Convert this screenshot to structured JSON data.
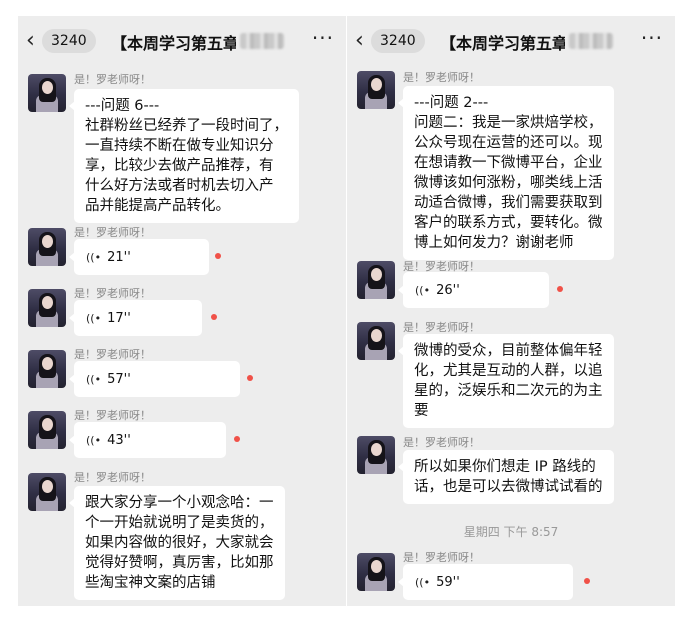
{
  "left_panel": {
    "back_count": "3240",
    "title": "【本周学习第五章",
    "more_label": "···",
    "messages": [
      {
        "type": "text",
        "sender": "是！罗老师呀！",
        "lines": [
          "---问题 6---",
          "社群粉丝已经养了一段时间了，",
          "一直持续不断在做专业知识分",
          "享，比较少去做产品推荐，有",
          "什么好方法或者时机去切入产",
          "品并能提高产品转化。"
        ]
      },
      {
        "type": "voice",
        "sender": "是！罗老师呀！",
        "duration": "21''"
      },
      {
        "type": "voice",
        "sender": "是！罗老师呀！",
        "duration": "17''"
      },
      {
        "type": "voice",
        "sender": "是！罗老师呀！",
        "duration": "57''"
      },
      {
        "type": "voice",
        "sender": "是！罗老师呀！",
        "duration": "43''"
      },
      {
        "type": "text",
        "sender": "是！罗老师呀！",
        "lines": [
          "跟大家分享一个小观念哈：一",
          "个一开始就说明了是卖货的，",
          "如果内容做的很好，大家就会",
          "觉得好赞啊，真厉害，比如那",
          "些淘宝神文案的店铺"
        ]
      }
    ]
  },
  "right_panel": {
    "back_count": "3240",
    "title": "【本周学习第五章",
    "more_label": "···",
    "timestamp": "星期四 下午 8:57",
    "messages": [
      {
        "type": "text",
        "sender": "是！罗老师呀！",
        "lines": [
          "---问题 2---",
          "问题二：我是一家烘焙学校，",
          "公众号现在运营的还可以。现",
          "在想请教一下微博平台，企业",
          "微博该如何涨粉，哪类线上活",
          "动适合微博，我们需要获取到",
          "客户的联系方式，要转化。微",
          "博上如何发力？谢谢老师"
        ]
      },
      {
        "type": "voice",
        "sender": "是！罗老师呀！",
        "duration": "26''"
      },
      {
        "type": "text",
        "sender": "是！罗老师呀！",
        "lines": [
          "微博的受众，目前整体偏年轻",
          "化，尤其是互动的人群，以追",
          "星的，泛娱乐和二次元的为主",
          "要"
        ]
      },
      {
        "type": "text",
        "sender": "是！罗老师呀！",
        "lines": [
          "所以如果你们想走 IP 路线的",
          "话，也是可以去微博试试看的"
        ]
      },
      {
        "type": "voice",
        "sender": "是！罗老师呀！",
        "duration": "59''"
      }
    ]
  },
  "icons": {
    "back": "chevron-left-icon",
    "more": "more-dots-icon",
    "voice": "voice-wave-icon",
    "unread": "unread-dot-icon"
  },
  "colors": {
    "chat_background": "#ededed",
    "bubble": "#ffffff",
    "unread_dot": "#f05148"
  }
}
